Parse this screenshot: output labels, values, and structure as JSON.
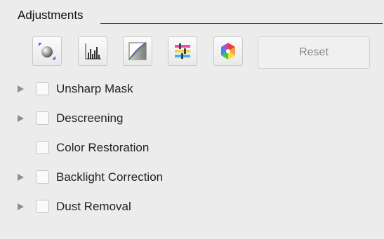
{
  "panel": {
    "title": "Adjustments",
    "toolbar": {
      "tools": [
        {
          "icon": "color-balance-sphere-icon"
        },
        {
          "icon": "histogram-icon"
        },
        {
          "icon": "tone-curve-icon"
        },
        {
          "icon": "color-sliders-icon"
        },
        {
          "icon": "color-palette-icon"
        }
      ],
      "reset_label": "Reset"
    },
    "options": [
      {
        "label": "Unsharp Mask",
        "checked": false,
        "expandable": true
      },
      {
        "label": "Descreening",
        "checked": false,
        "expandable": true
      },
      {
        "label": "Color Restoration",
        "checked": false,
        "expandable": false
      },
      {
        "label": "Backlight Correction",
        "checked": false,
        "expandable": true
      },
      {
        "label": "Dust Removal",
        "checked": false,
        "expandable": true
      }
    ]
  }
}
